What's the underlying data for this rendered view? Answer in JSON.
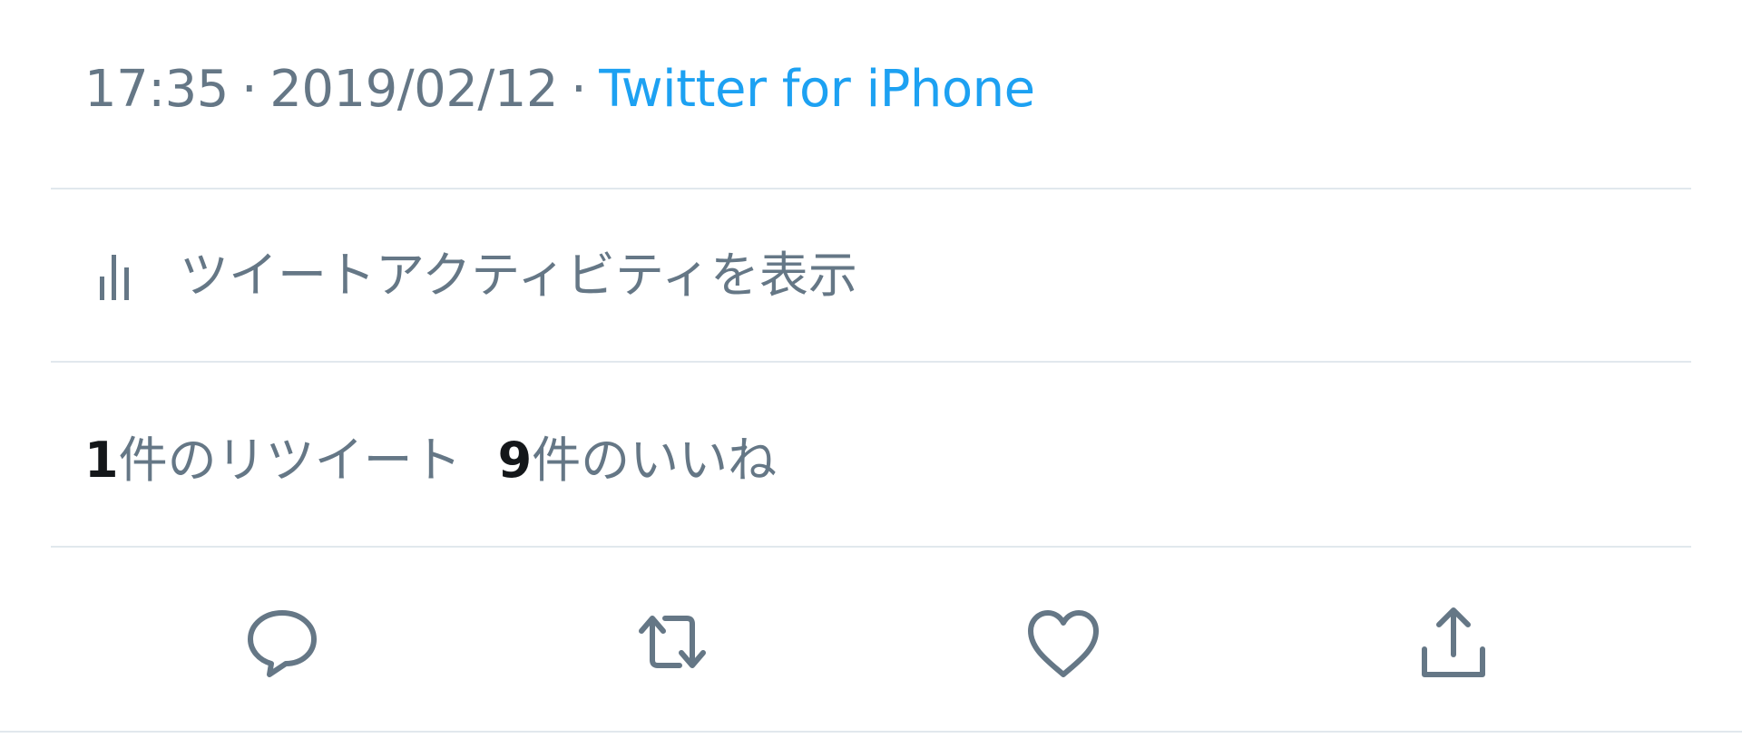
{
  "tweet_meta": {
    "time": "17:35",
    "separator": "·",
    "date": "2019/02/12",
    "source": "Twitter for iPhone"
  },
  "activity": {
    "icon": "bar-chart-icon",
    "label": "ツイートアクティビティを表示"
  },
  "stats": {
    "retweets": {
      "count": "1",
      "label": "件のリツイート"
    },
    "likes": {
      "count": "9",
      "label": "件のいいね"
    }
  },
  "actions": [
    {
      "name": "reply",
      "icon": "reply-icon"
    },
    {
      "name": "retweet",
      "icon": "retweet-icon"
    },
    {
      "name": "like",
      "icon": "heart-icon"
    },
    {
      "name": "share",
      "icon": "share-icon"
    }
  ],
  "colors": {
    "text_secondary": "#657786",
    "link": "#1da1f2",
    "text_primary": "#14171a",
    "divider": "#e1e8ed"
  }
}
